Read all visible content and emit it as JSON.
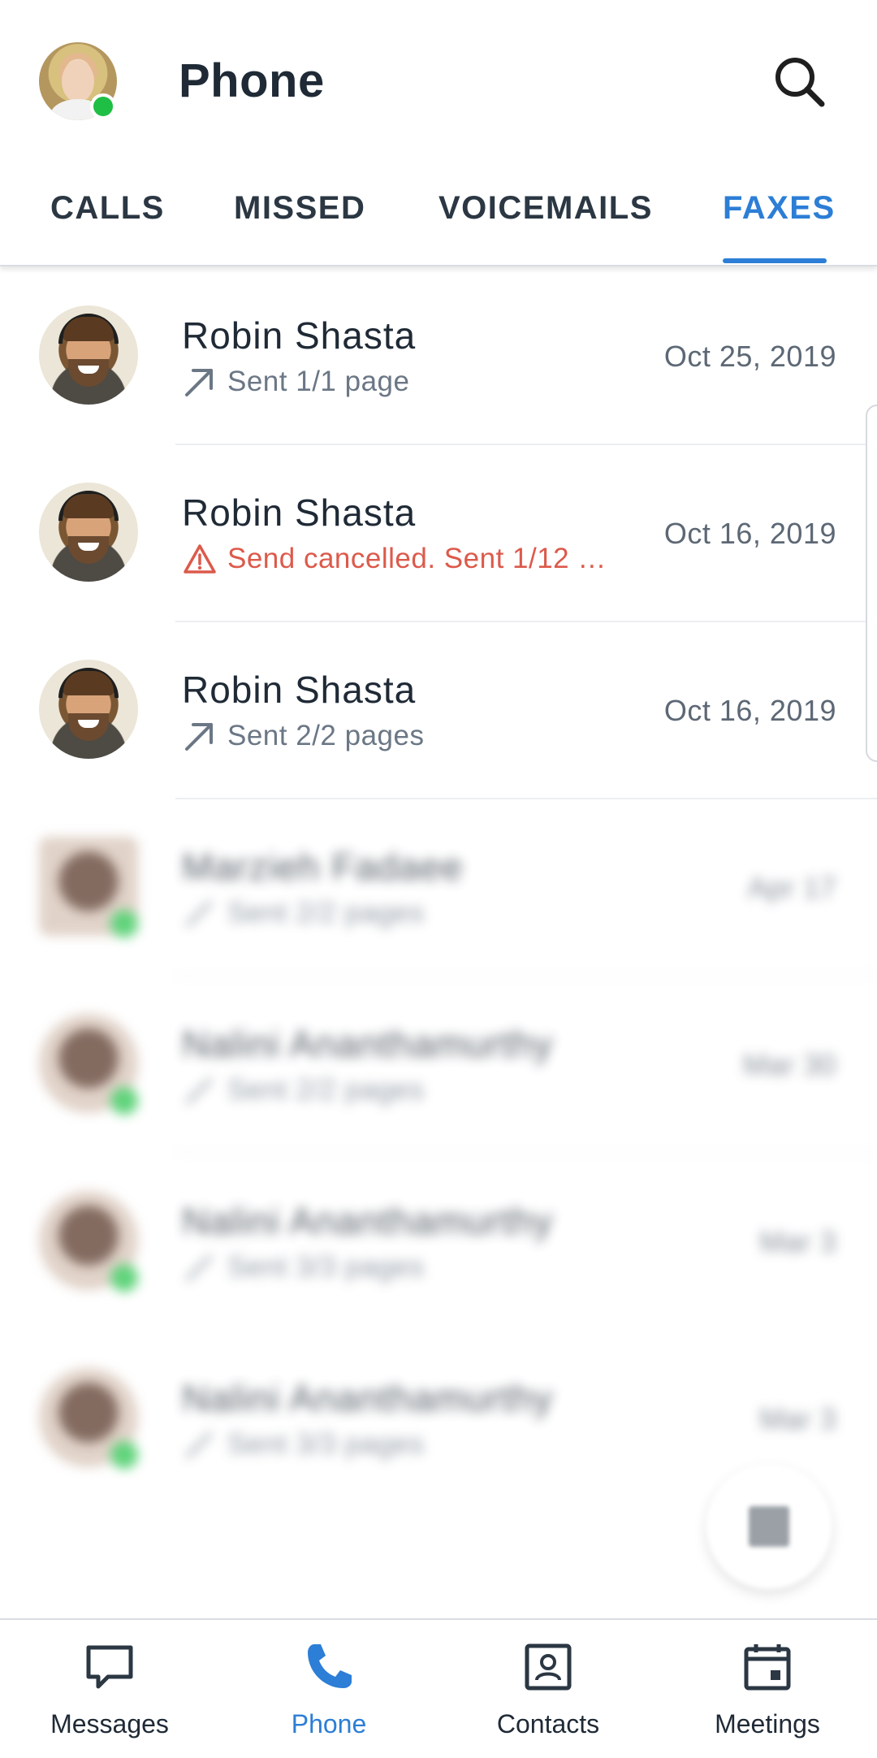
{
  "header": {
    "title": "Phone",
    "search_icon": "search-icon",
    "presence": "online"
  },
  "tabs": [
    {
      "label": "CALLS",
      "active": false
    },
    {
      "label": "MISSED",
      "active": false
    },
    {
      "label": "VOICEMAILS",
      "active": false
    },
    {
      "label": "FAXES",
      "active": true
    }
  ],
  "faxes": [
    {
      "name": "Robin Shasta",
      "status": "Sent 1/1 page",
      "status_type": "sent",
      "date": "Oct 25, 2019",
      "blurred": false
    },
    {
      "name": "Robin Shasta",
      "status": "Send cancelled. Sent 1/12 …",
      "status_type": "error",
      "date": "Oct 16, 2019",
      "blurred": false
    },
    {
      "name": "Robin Shasta",
      "status": "Sent 2/2 pages",
      "status_type": "sent",
      "date": "Oct 16, 2019",
      "blurred": false
    },
    {
      "name": "Marzieh Fadaee",
      "status": "Sent 2/2 pages",
      "status_type": "sent",
      "date": "Apr 17",
      "blurred": true
    },
    {
      "name": "Nalini Ananthamurthy",
      "status": "Sent 2/2 pages",
      "status_type": "sent",
      "date": "Mar 30",
      "blurred": true
    },
    {
      "name": "Nalini Ananthamurthy",
      "status": "Sent 3/3 pages",
      "status_type": "sent",
      "date": "Mar 3",
      "blurred": true
    },
    {
      "name": "Nalini Ananthamurthy",
      "status": "Sent 3/3 pages",
      "status_type": "sent",
      "date": "Mar 3",
      "blurred": true
    }
  ],
  "bottom_nav": [
    {
      "label": "Messages",
      "icon": "chat-bubble-icon",
      "active": false
    },
    {
      "label": "Phone",
      "icon": "phone-icon",
      "active": true
    },
    {
      "label": "Contacts",
      "icon": "contact-card-icon",
      "active": false
    },
    {
      "label": "Meetings",
      "icon": "calendar-icon",
      "active": false
    }
  ],
  "colors": {
    "accent": "#2c7ed6",
    "error": "#dc5a4b",
    "presence_online": "#1fbf45",
    "text_primary": "#1f2a36",
    "text_secondary": "#6b7785"
  }
}
